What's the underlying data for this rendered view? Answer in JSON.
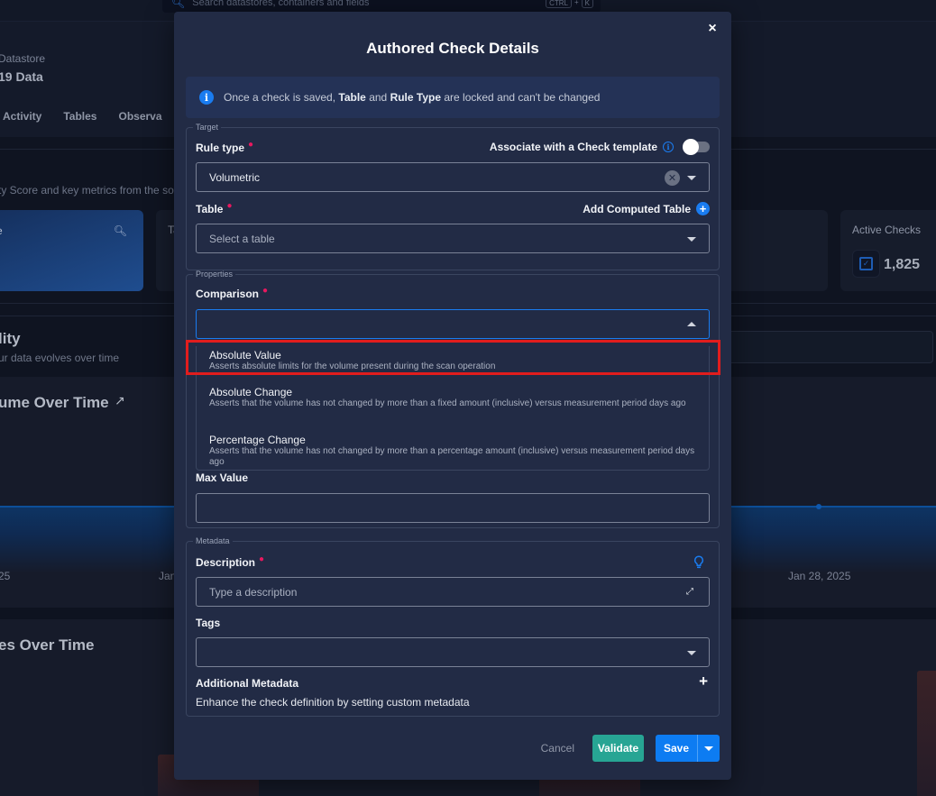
{
  "background": {
    "search_placeholder": "Search datastores, containers and fields",
    "search_shortcut": [
      "CTRL",
      "+",
      "K"
    ],
    "datastore_label": "Datastore",
    "datastore_name": "19 Data",
    "tabs": [
      "Activity",
      "Tables",
      "Observa"
    ],
    "subtitle": "ty Score and key metrics from the so",
    "quality_card_label": "e",
    "tables_card_label": "Ta",
    "active_checks_label": "Active Checks",
    "active_checks_value": "1,825",
    "quality_title": "lity",
    "quality_subtitle": "ur data evolves over time",
    "volume_chart_title": "ume Over Time",
    "volume_chart_ticks": [
      "25",
      "Jan",
      "Jan 28, 2025"
    ],
    "changes_chart_title": "es Over Time"
  },
  "modal": {
    "title": "Authored Check Details",
    "close_label": "×",
    "info_banner": {
      "prefix": "Once a check is saved, ",
      "bold1": "Table",
      "mid": " and ",
      "bold2": "Rule Type",
      "suffix": " are locked and can't be changed"
    },
    "target": {
      "legend": "Target",
      "rule_type_label": "Rule type",
      "rule_type_value": "Volumetric",
      "check_template_label": "Associate with a Check template",
      "check_template_enabled": false,
      "table_label": "Table",
      "table_placeholder": "Select a table",
      "add_computed_table_label": "Add Computed Table"
    },
    "properties": {
      "legend": "Properties",
      "comparison_label": "Comparison",
      "comparison_value": "",
      "comparison_options": [
        {
          "name": "Absolute Value",
          "description": "Asserts absolute limits for the volume present during the scan operation",
          "highlighted": true
        },
        {
          "name": "Absolute Change",
          "description": "Asserts that the volume has not changed by more than a fixed amount (inclusive) versus measurement period days ago",
          "highlighted": false
        },
        {
          "name": "Percentage Change",
          "description": "Asserts that the volume has not changed by more than a percentage amount (inclusive) versus measurement period days ago",
          "highlighted": false
        }
      ],
      "max_value_label": "Max Value",
      "max_value": ""
    },
    "metadata": {
      "legend": "Metadata",
      "description_label": "Description",
      "description_placeholder": "Type a description",
      "tags_label": "Tags",
      "tags_value": "",
      "additional_metadata_label": "Additional Metadata",
      "additional_metadata_desc": "Enhance the check definition by setting custom metadata"
    },
    "footer": {
      "cancel_label": "Cancel",
      "validate_label": "Validate",
      "save_label": "Save"
    }
  },
  "colors": {
    "primary": "#0d7cf2",
    "validate": "#27a594",
    "required": "#e8185f",
    "highlight": "#e11d1d"
  }
}
